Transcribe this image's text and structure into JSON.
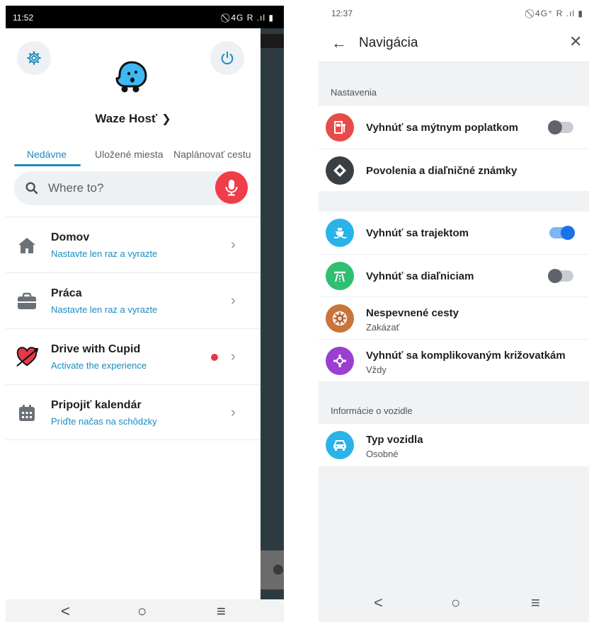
{
  "left": {
    "status": {
      "time": "11:52",
      "icons": "⃠ 4G R .ıl ▮"
    },
    "profile_name": "Waze Hosť",
    "tabs": [
      {
        "label": "Nedávne"
      },
      {
        "label": "Uložené miesta"
      },
      {
        "label": "Naplánovať cestu"
      }
    ],
    "search": {
      "placeholder": "Where to?"
    },
    "items": [
      {
        "title": "Domov",
        "subtitle": "Nastavte len raz a vyrazte",
        "icon": "home-icon"
      },
      {
        "title": "Práca",
        "subtitle": "Nastavte len raz a vyrazte",
        "icon": "briefcase-icon"
      },
      {
        "title": "Drive with Cupid",
        "subtitle": "Activate the experience",
        "icon": "cupid-heart-icon"
      },
      {
        "title": "Pripojiť kalendár",
        "subtitle": "Príďte načas na schôdzky",
        "icon": "calendar-icon"
      }
    ],
    "colors": {
      "accent": "#1a8bbf",
      "mic": "#ef3d4a",
      "badge": "#e53946"
    }
  },
  "right": {
    "status": {
      "time": "12:37",
      "icons": "⃠ 4G⁺ R .ıl ▮"
    },
    "header": {
      "title": "Navigácia"
    },
    "section1": {
      "label": "Nastavenia"
    },
    "group1": [
      {
        "title": "Vyhnúť sa mýtnym poplatkom",
        "icon": "toll-icon",
        "toggle": false,
        "color": "#e84a4a"
      },
      {
        "title": "Povolenia a diaľničné známky",
        "icon": "diamond-sign-icon",
        "color": "#3a3f44"
      }
    ],
    "group2": [
      {
        "title": "Vyhnúť sa trajektom",
        "icon": "ferry-icon",
        "toggle": true,
        "color": "#2ab3e6"
      },
      {
        "title": "Vyhnúť sa diaľniciam",
        "icon": "highway-icon",
        "toggle": false,
        "color": "#2fbf71"
      },
      {
        "title": "Nespevnené cesty",
        "subtitle": "Zakázať",
        "icon": "unpaved-road-icon",
        "color": "#c9743a"
      },
      {
        "title": "Vyhnúť sa komplikovaným križovatkám",
        "subtitle": "Vždy",
        "icon": "junction-icon",
        "color": "#9a3fd1"
      }
    ],
    "section2": {
      "label": "Informácie o vozidle"
    },
    "group3": [
      {
        "title": "Typ vozidla",
        "subtitle": "Osobné",
        "icon": "car-icon",
        "color": "#2ab3e6"
      }
    ]
  },
  "navbar": {
    "back": "<",
    "home": "○",
    "recents": "≡"
  }
}
